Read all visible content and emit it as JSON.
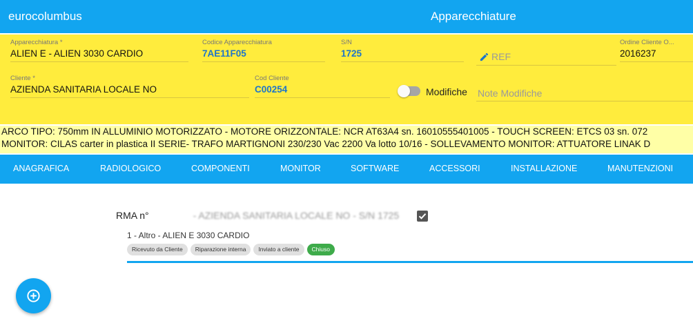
{
  "app": {
    "brand": "eurocolumbus",
    "title": "Apparecchiature"
  },
  "form": {
    "apparecchiatura": {
      "label": "Apparecchiatura *",
      "value": "ALIEN E - ALIEN 3030 CARDIO"
    },
    "codice": {
      "label": "Codice Apparecchiatura",
      "value": "7AE11F05"
    },
    "sn": {
      "label": "S/N",
      "value": "1725"
    },
    "ref": {
      "placeholder": "REF"
    },
    "ordine": {
      "label": "Ordine Cliente O...",
      "value": "2016237"
    },
    "cliente": {
      "label": "Cliente *",
      "value": "AZIENDA SANITARIA LOCALE NO"
    },
    "cod_cliente": {
      "label": "Cod Cliente",
      "value": "C00254"
    },
    "modifiche_label": "Modifiche",
    "note_placeholder": "Note Modifiche"
  },
  "marquee": {
    "line1": "ARCO TIPO: 750mm IN ALLUMINIO MOTORIZZATO - MOTORE ORIZZONTALE: NCR AT63A4 sn. 16010555401005 - TOUCH SCREEN: ETCS 03 sn. 072",
    "line2": "MONITOR: CILAS carter in plastica II SERIE- TRAFO MARTIGNONI 230/230 Vac 2200 Va lotto 10/16 - SOLLEVAMENTO MONITOR: ATTUATORE LINAK D"
  },
  "tabs": [
    "ANAGRAFICA",
    "RADIOLOGICO",
    "COMPONENTI",
    "MONITOR",
    "SOFTWARE",
    "ACCESSORI",
    "INSTALLAZIONE",
    "MANUTENZIONI"
  ],
  "rma": {
    "prefix": "RMA n°",
    "rest": "- AZIENDA SANITARIA LOCALE NO - S/N 1725",
    "item": "1 - Altro - ALIEN E 3030 CARDIO",
    "chips": [
      "Ricevuto da Cliente",
      "Riparazione interna",
      "Inviato a cliente",
      "Chiuso"
    ]
  },
  "colors": {
    "primary": "#12a5f0",
    "form_bg": "#ffec3d",
    "marquee_bg": "#ffffa6",
    "chip_active": "#3eab4a",
    "code_blue": "#1d75c9"
  },
  "icons": {
    "ref": "pencil-icon",
    "fab": "add-circle-icon",
    "check": "checkbox-checked-icon"
  }
}
